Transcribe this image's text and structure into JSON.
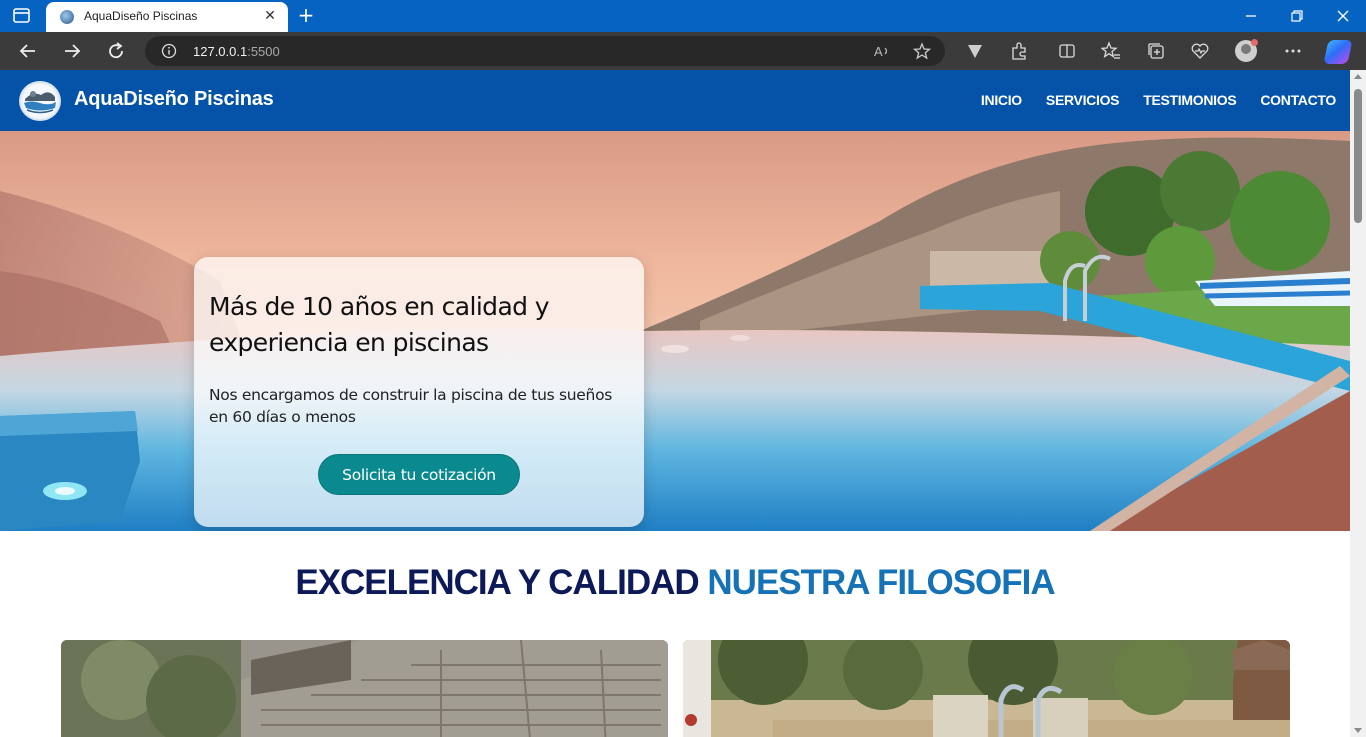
{
  "browser": {
    "tab_title": "AquaDiseño Piscinas",
    "url_host": "127.0.0.1",
    "url_port": ":5500"
  },
  "site": {
    "brand": "AquaDiseño Piscinas",
    "menu": [
      "INICIO",
      "SERVICIOS",
      "TESTIMONIOS",
      "CONTACTO"
    ]
  },
  "hero": {
    "title": "Más de 10 años en calidad y experiencia en piscinas",
    "subtitle": "Nos encargamos de construir la piscina de tus sueños en 60 días o menos",
    "cta": "Solicita tu cotización"
  },
  "section": {
    "title_part1": "EXCELENCIA Y CALIDAD",
    "title_part2": "NUESTRA FILOSOFIA"
  },
  "colors": {
    "header_blue": "#0553a9",
    "cta_teal": "#0a8a8e",
    "title_navy": "#0d1a5a",
    "title_blue": "#1572b6"
  },
  "icons": [
    "sidebar-icon",
    "close-icon",
    "plus-icon",
    "minimize-icon",
    "restore-icon",
    "back-icon",
    "forward-icon",
    "refresh-icon",
    "info-icon",
    "read-aloud-icon",
    "star-icon",
    "extension-icon",
    "split-icon",
    "favorites-icon",
    "collections-icon",
    "health-icon",
    "more-icon"
  ]
}
